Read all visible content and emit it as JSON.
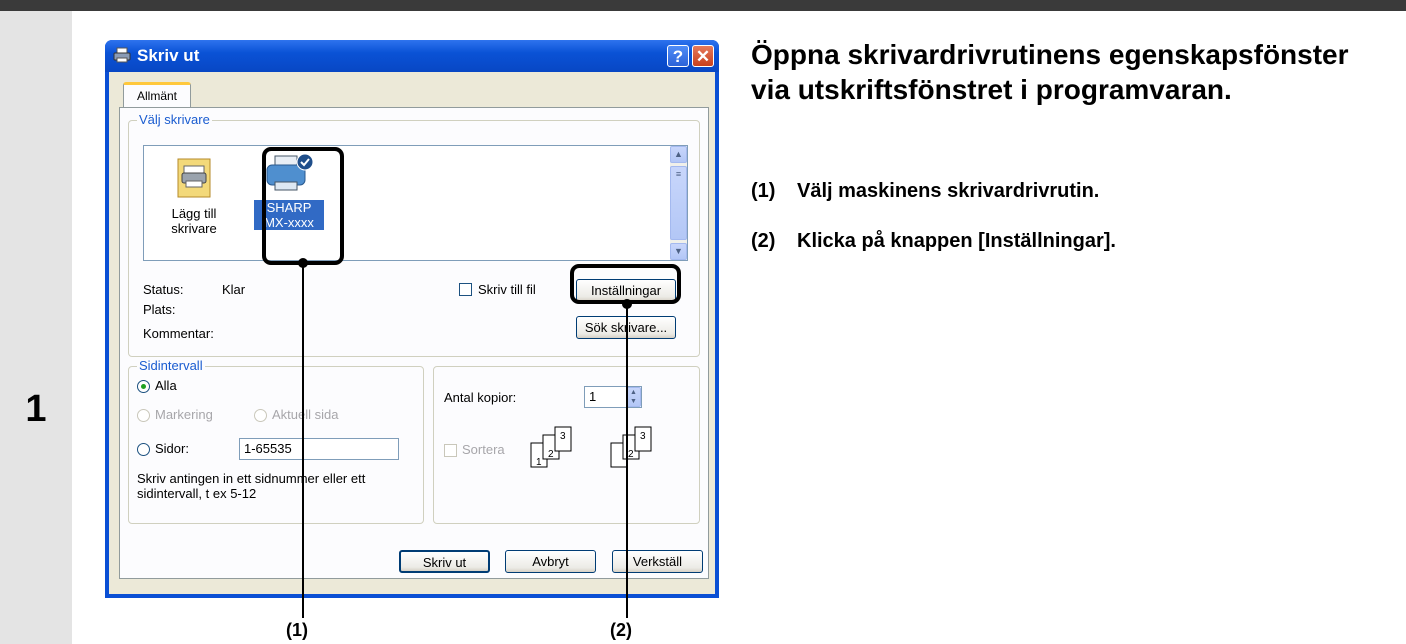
{
  "step_number": "1",
  "dialog": {
    "title": "Skriv ut",
    "help_label": "?",
    "close_label": "✕",
    "tab_label": "Allmänt",
    "printer_group_label": "Välj skrivare",
    "printers": [
      {
        "name": "Lägg till skrivare",
        "line1": "Lägg till",
        "line2": "skrivare",
        "selected": false
      },
      {
        "name": "SHARP MX-xxxx",
        "line1": "SHARP",
        "line2": "MX-xxxx",
        "selected": true
      }
    ],
    "status_label": "Status:",
    "status_value": "Klar",
    "location_label": "Plats:",
    "comment_label": "Kommentar:",
    "print_to_file_label": "Skriv till fil",
    "settings_button": "Inställningar",
    "find_printer_button": "Sök skrivare...",
    "page_range_label": "Sidintervall",
    "all_label": "Alla",
    "selection_label": "Markering",
    "current_page_label": "Aktuell sida",
    "pages_label": "Sidor:",
    "pages_value": "1-65535",
    "pages_help": [
      "Skriv antingen in ett sidnummer eller ett",
      "sidintervall, t ex 5-12"
    ],
    "copies_label": "Antal kopior:",
    "copies_value": "1",
    "collate_label": "Sortera",
    "collate_pages": [
      "1",
      "2",
      "3"
    ],
    "print_button": "Skriv ut",
    "cancel_button": "Avbryt",
    "apply_button": "Verkställ"
  },
  "callouts": {
    "c1": "(1)",
    "c2": "(2)"
  },
  "instructions": {
    "heading": "Öppna skrivardrivrutinens egenskapsfönster via utskriftsfönstret i programvaran.",
    "steps": [
      {
        "num": "(1)",
        "text": "Välj maskinens skrivardrivrutin."
      },
      {
        "num": "(2)",
        "text": "Klicka på knappen [Inställningar]."
      }
    ]
  }
}
